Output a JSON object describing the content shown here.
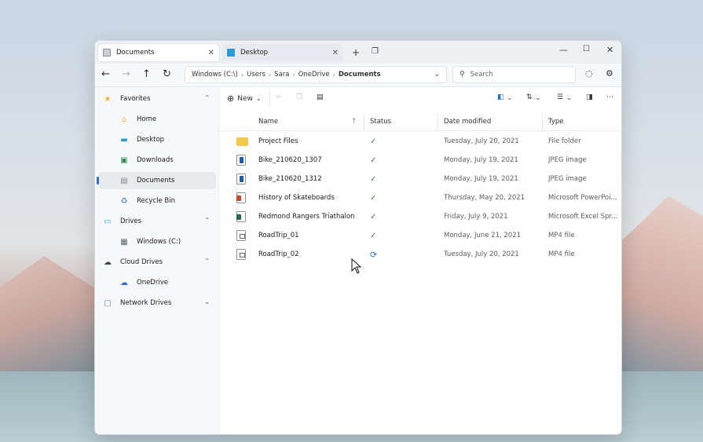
{
  "tabs": [
    {
      "label": "Documents",
      "active": true
    },
    {
      "label": "Desktop",
      "active": false
    }
  ],
  "address": {
    "crumbs": [
      "Windows (C:\\)",
      "Users",
      "Sara",
      "OneDrive",
      "Documents"
    ]
  },
  "search": {
    "placeholder": "Search"
  },
  "sidebar": {
    "favorites_label": "Favorites",
    "favorites": [
      {
        "label": "Home",
        "icon": "home-icon"
      },
      {
        "label": "Desktop",
        "icon": "desktop-icon"
      },
      {
        "label": "Downloads",
        "icon": "downloads-icon"
      },
      {
        "label": "Documents",
        "icon": "documents-icon",
        "selected": true
      },
      {
        "label": "Recycle Bin",
        "icon": "recycle-bin-icon"
      }
    ],
    "drives_label": "Drives",
    "drives": [
      {
        "label": "Windows (C:)",
        "icon": "drive-icon"
      }
    ],
    "cloud_label": "Cloud Drives",
    "cloud": [
      {
        "label": "OneDrive",
        "icon": "onedrive-icon"
      }
    ],
    "network_label": "Network Drives"
  },
  "commandbar": {
    "new_label": "New"
  },
  "columns": {
    "name": "Name",
    "status": "Status",
    "date": "Date modified",
    "type": "Type"
  },
  "files": [
    {
      "name": "Project Files",
      "status": "synced",
      "date": "Tuesday, July 20, 2021",
      "type": "File folder",
      "icon": "folder-icon"
    },
    {
      "name": "Bike_210620_1307",
      "status": "synced",
      "date": "Monday, July 19, 2021",
      "type": "JPEG image",
      "icon": "image-file-icon"
    },
    {
      "name": "Bike_210620_1312",
      "status": "synced",
      "date": "Monday, July 19, 2021",
      "type": "JPEG image",
      "icon": "image-file-icon"
    },
    {
      "name": "History of Skateboards",
      "status": "synced",
      "date": "Thursday, May 20, 2021",
      "type": "Microsoft PowerPoi...",
      "icon": "powerpoint-file-icon"
    },
    {
      "name": "Redmond Rangers Triathalon",
      "status": "synced",
      "date": "Friday, July 9, 2021",
      "type": "Microsoft Excel Spr...",
      "icon": "excel-file-icon"
    },
    {
      "name": "RoadTrip_01",
      "status": "synced",
      "date": "Monday, June 21, 2021",
      "type": "MP4 file",
      "icon": "video-file-icon"
    },
    {
      "name": "RoadTrip_02",
      "status": "syncing",
      "date": "Tuesday, July 20, 2021",
      "type": "MP4 file",
      "icon": "video-file-icon"
    }
  ],
  "colors": {
    "accent": "#2a6fd6",
    "synced": "#2e8b57",
    "folder": "#f3c84b"
  }
}
